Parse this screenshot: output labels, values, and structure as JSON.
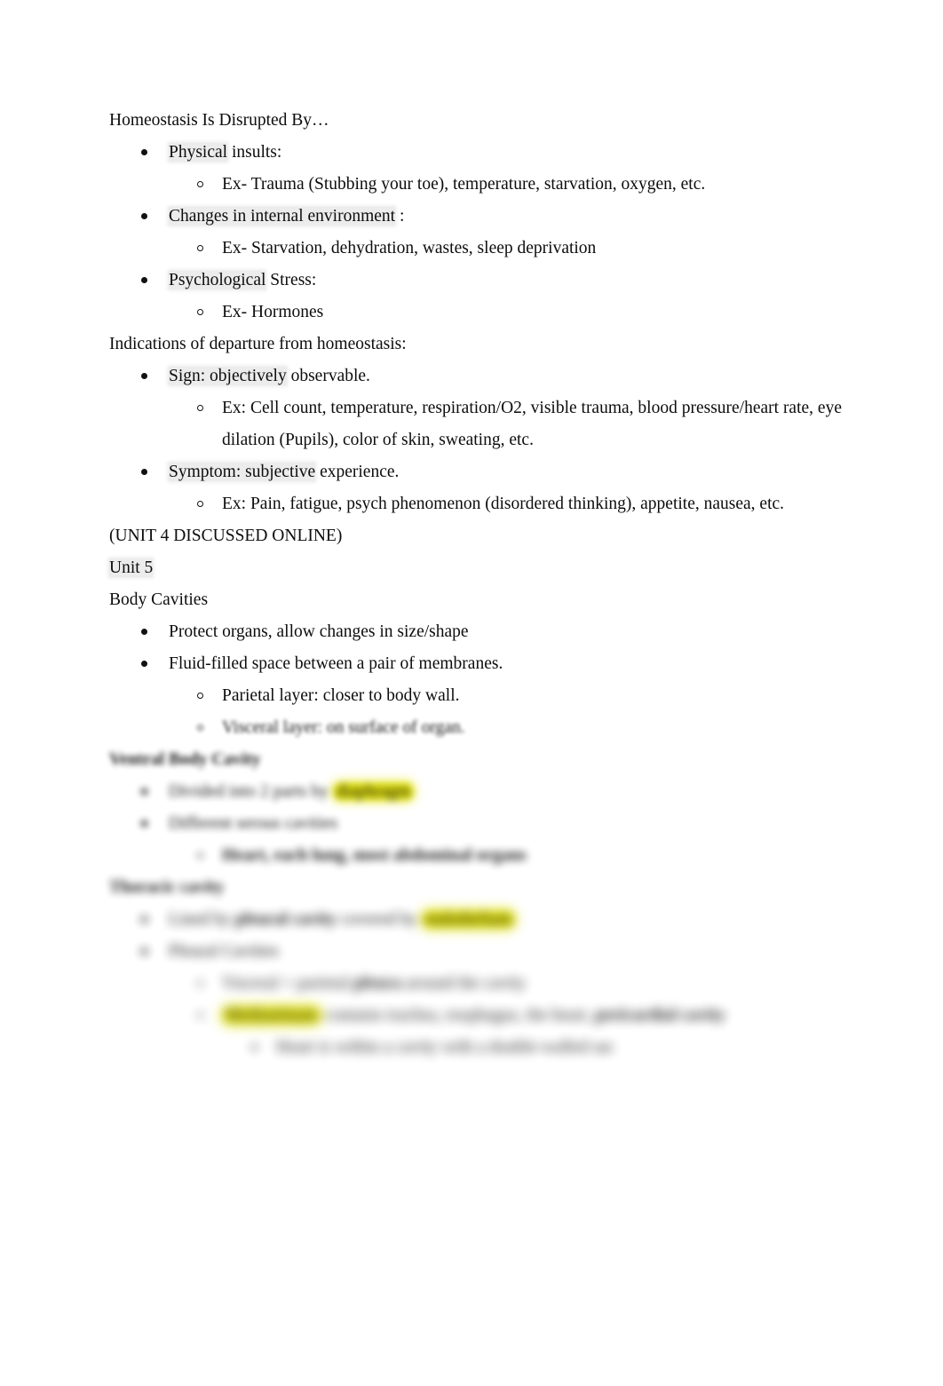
{
  "document": {
    "type": "lecture-notes",
    "page_background": "#ffffff",
    "text_color": "#0d0d0d",
    "highlight_color": "#dede00",
    "shade_color": "#ececec",
    "sections": [
      {
        "id": "homeostasis-disrupted",
        "heading": "Homeostasis Is Disrupted By…",
        "items": [
          {
            "level": 1,
            "text_a": "Physical",
            "text_b": " insults:",
            "shaded": true
          },
          {
            "level": 2,
            "text_a": "Ex- Trauma (Stubbing your toe), temperature, starvation, oxygen, etc.",
            "text_b": "",
            "shaded": false
          },
          {
            "level": 1,
            "text_a": "Changes in internal environment",
            "text_b": "  :",
            "shaded": true
          },
          {
            "level": 2,
            "text_a": "Ex- Starvation, dehydration, wastes, sleep deprivation",
            "text_b": "",
            "shaded": false
          },
          {
            "level": 1,
            "text_a": "Psychological",
            "text_b": " Stress:",
            "shaded": true
          },
          {
            "level": 2,
            "text_a": "Ex- Hormones",
            "text_b": "",
            "shaded": false
          }
        ]
      },
      {
        "id": "indications",
        "heading": "Indications of departure from homeostasis:",
        "items": [
          {
            "level": 1,
            "text_a": "Sign: objectively",
            "text_b": " observable.",
            "shaded": true
          },
          {
            "level": 2,
            "text_a": "Ex: Cell count, temperature, respiration/O2, visible trauma, blood pressure/heart rate, eye dilation (Pupils), color of skin, sweating, etc.",
            "text_b": "",
            "shaded": false
          },
          {
            "level": 1,
            "text_a": "Symptom:  subjective",
            "text_b": " experience.",
            "shaded": true
          },
          {
            "level": 2,
            "text_a": "Ex: Pain, fatigue, psych phenomenon (disordered thinking), appetite, nausea, etc.",
            "text_b": "",
            "shaded": false
          }
        ]
      }
    ],
    "unit_note": "(UNIT 4 DISCUSSED ONLINE)",
    "unit_label": "Unit 5",
    "body_cavities": {
      "heading": "Body Cavities",
      "items": [
        {
          "level": 1,
          "text": "Protect organs, allow changes in size/shape"
        },
        {
          "level": 1,
          "text": "Fluid-filled space between a pair of membranes."
        },
        {
          "level": 2,
          "text": "Parietal layer: closer to body wall."
        }
      ]
    },
    "blurred_section": {
      "note": "lower portion of page is heavily blurred / illegible",
      "lines": [
        {
          "level": 2,
          "blur": 1,
          "bold": false,
          "segments": [
            {
              "text": "Visceral layer:  on surface of organ.",
              "highlight": false
            }
          ]
        },
        {
          "level": 0,
          "blur": 2,
          "bold": true,
          "segments": [
            {
              "text": "Ventral Body Cavity",
              "highlight": false
            }
          ]
        },
        {
          "level": 1,
          "blur": 3,
          "bold": false,
          "segments": [
            {
              "text": "Divided into 2 parts by ",
              "highlight": false
            },
            {
              "text": "diaphragm",
              "highlight": true
            }
          ]
        },
        {
          "level": 1,
          "blur": 3,
          "bold": false,
          "segments": [
            {
              "text": "Different serous cavities",
              "highlight": false
            }
          ]
        },
        {
          "level": 2,
          "blur": 4,
          "bold": true,
          "segments": [
            {
              "text": "Heart, each lung, most abdominal organs",
              "highlight": false
            }
          ]
        },
        {
          "level": 0,
          "blur": 4,
          "bold": true,
          "segments": [
            {
              "text": "Thoracic cavity",
              "highlight": false
            }
          ]
        },
        {
          "level": 1,
          "blur": 5,
          "bold": false,
          "segments": [
            {
              "text": "Lined by ",
              "highlight": false
            },
            {
              "text": "pleural cavity",
              "highlight": false,
              "bold": true
            },
            {
              "text": " covered by ",
              "highlight": false
            },
            {
              "text": "endothelium",
              "highlight": true
            }
          ]
        },
        {
          "level": 1,
          "blur": 5,
          "bold": false,
          "segments": [
            {
              "text": "Pleural Cavities",
              "highlight": false
            }
          ]
        },
        {
          "level": 2,
          "blur": 6,
          "bold": false,
          "segments": [
            {
              "text": "Visceral + parietal ",
              "highlight": false
            },
            {
              "text": "pleura",
              "highlight": false,
              "bold": true
            },
            {
              "text": " around the cavity",
              "highlight": false
            }
          ]
        },
        {
          "level": 2,
          "blur": 6,
          "bold": false,
          "segments": [
            {
              "text": "Mediastinum",
              "highlight": true
            },
            {
              "text": " contains trachea, esophagus, the heart, ",
              "highlight": false
            },
            {
              "text": "pericardial cavity",
              "highlight": false,
              "bold": true
            }
          ]
        },
        {
          "level": 3,
          "blur": 6,
          "bold": false,
          "segments": [
            {
              "text": "Heart is within a cavity with a double-walled sac",
              "highlight": false
            }
          ]
        }
      ]
    }
  }
}
